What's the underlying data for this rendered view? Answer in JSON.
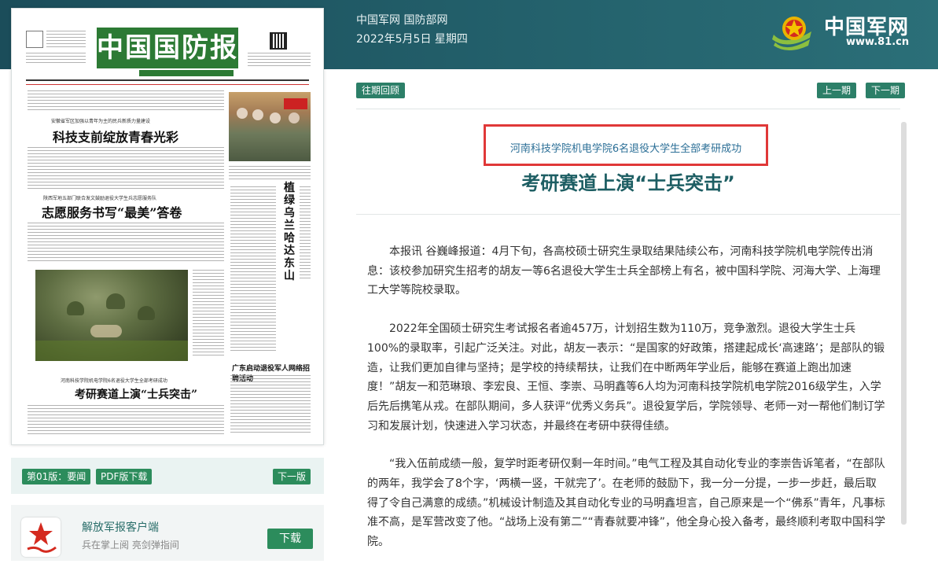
{
  "header": {
    "site_line": "中国军网 国防部网",
    "date_line": "2022年5月5日 星期四",
    "logo_title": "中国军网",
    "logo_url": "www.81.cn"
  },
  "paper": {
    "masthead": "中国国防报",
    "head1_small": "安徽省军区加强以青年为主的民兵新质力量建设",
    "head1_big": "科技支前绽放青春光彩",
    "head2_small": "陕西军地五部门联合发文鼓励退役大学生兵志愿服务队",
    "head2_big": "志愿服务书写“最美”答卷",
    "vert_head": "植绿乌兰哈达东山",
    "head3_small": "河南科技学院机电学院6名退役大学生全部考研成功",
    "head3_big": "考研赛道上演“士兵突击”",
    "head4_big": "广东启动退役军人网络招聘活动"
  },
  "edition_bar": {
    "page_label": "第01版：要闻",
    "pdf_label": "PDF版下载",
    "next_label": "下一版"
  },
  "client": {
    "title": "解放军报客户端",
    "subtitle": "兵在掌上阅 亮剑弹指间",
    "download_label": "下载"
  },
  "article_nav": {
    "archive_label": "往期回顾",
    "prev_label": "上一期",
    "next_label": "下一期"
  },
  "article": {
    "subheading": "河南科技学院机电学院6名退役大学生全部考研成功",
    "title": "考研赛道上演“士兵突击”",
    "paragraphs": [
      "本报讯 谷巍峰报道：4月下旬，各高校硕士研究生录取结果陆续公布，河南科技学院机电学院传出消息：该校参加研究生招考的胡友一等6名退役大学生士兵全部榜上有名，被中国科学院、河海大学、上海理工大学等院校录取。",
      "2022年全国硕士研究生考试报名者逾457万，计划招生数为110万，竞争激烈。退役大学生士兵100%的录取率，引起广泛关注。对此，胡友一表示：“是国家的好政策，搭建起成长‘高速路’；是部队的锻造，让我们更加自律与坚持；是学校的持续帮扶，让我们在中断两年学业后，能够在赛道上跑出加速度！”胡友一和范琳琅、李宏良、王恒、李崇、马明鑫等6人均为河南科技学院机电学院2016级学生，入学后先后携笔从戎。在部队期间，多人获评“优秀义务兵”。退役复学后，学院领导、老师一对一帮他们制订学习和发展计划，快速进入学习状态，并最终在考研中获得佳绩。",
      "“我入伍前成绩一般，复学时距考研仅剩一年时间。”电气工程及其自动化专业的李崇告诉笔者，“在部队的两年，我学会了8个字，‘两横一竖，干就完了’。在老师的鼓励下，我一分一分提，一步一步赶，最后取得了令自己满意的成绩。”机械设计制造及其自动化专业的马明鑫坦言，自己原来是一个“佛系”青年，凡事标准不高，是军营改变了他。“战场上没有第二”“青春就要冲锋”，他全身心投入备考，最终顺利考取中国科学院。"
    ]
  },
  "colors": {
    "header_bg": "#1b4d5a",
    "accent_green": "#2c8c5c",
    "title_color": "#1d5e63",
    "highlight_box": "#e03838",
    "masthead_green": "#2c7a34"
  }
}
